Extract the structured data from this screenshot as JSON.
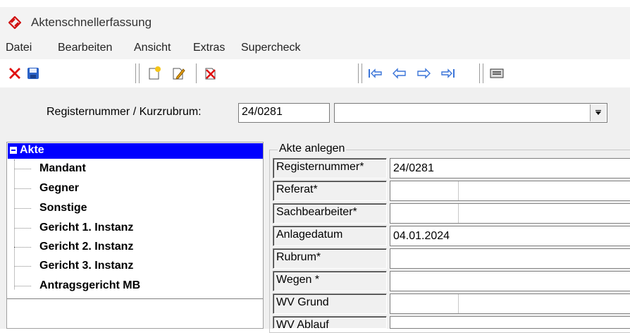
{
  "window": {
    "title": "Aktenschnellerfassung",
    "app_icon": "red-diamond-arrows-icon",
    "accent": "#d01010"
  },
  "menu": [
    "Datei",
    "Bearbeiten",
    "Ansicht",
    "Extras",
    "Supercheck"
  ],
  "toolbar": {
    "buttons": [
      "close-red-x-icon",
      "save-disk-icon",
      "new-document-icon",
      "edit-document-icon",
      "delete-document-icon",
      "first-record-icon",
      "previous-record-icon",
      "next-record-icon",
      "last-record-icon",
      "keyboard-icon"
    ]
  },
  "register": {
    "label": "Registernummer / Kurzrubrum:",
    "number_value": "24/0281",
    "rubrum_value": ""
  },
  "tree": {
    "root": "Akte",
    "items": [
      "Mandant",
      "Gegner",
      "Sonstige",
      "Gericht 1. Instanz",
      "Gericht 2. Instanz",
      "Gericht 3. Instanz",
      "Antragsgericht MB"
    ],
    "selection_color": "#0000ff"
  },
  "form": {
    "group_title": "Akte anlegen",
    "fields": [
      {
        "label": "Registernummer*",
        "value": "24/0281"
      },
      {
        "label": "Referat*",
        "value": ""
      },
      {
        "label": "Sachbearbeiter*",
        "value": ""
      },
      {
        "label": "Anlagedatum",
        "value": "04.01.2024"
      },
      {
        "label": "Rubrum*",
        "value": ""
      },
      {
        "label": "Wegen *",
        "value": ""
      },
      {
        "label": "WV Grund",
        "value": ""
      },
      {
        "label": "WV Ablauf",
        "value": ""
      }
    ]
  }
}
